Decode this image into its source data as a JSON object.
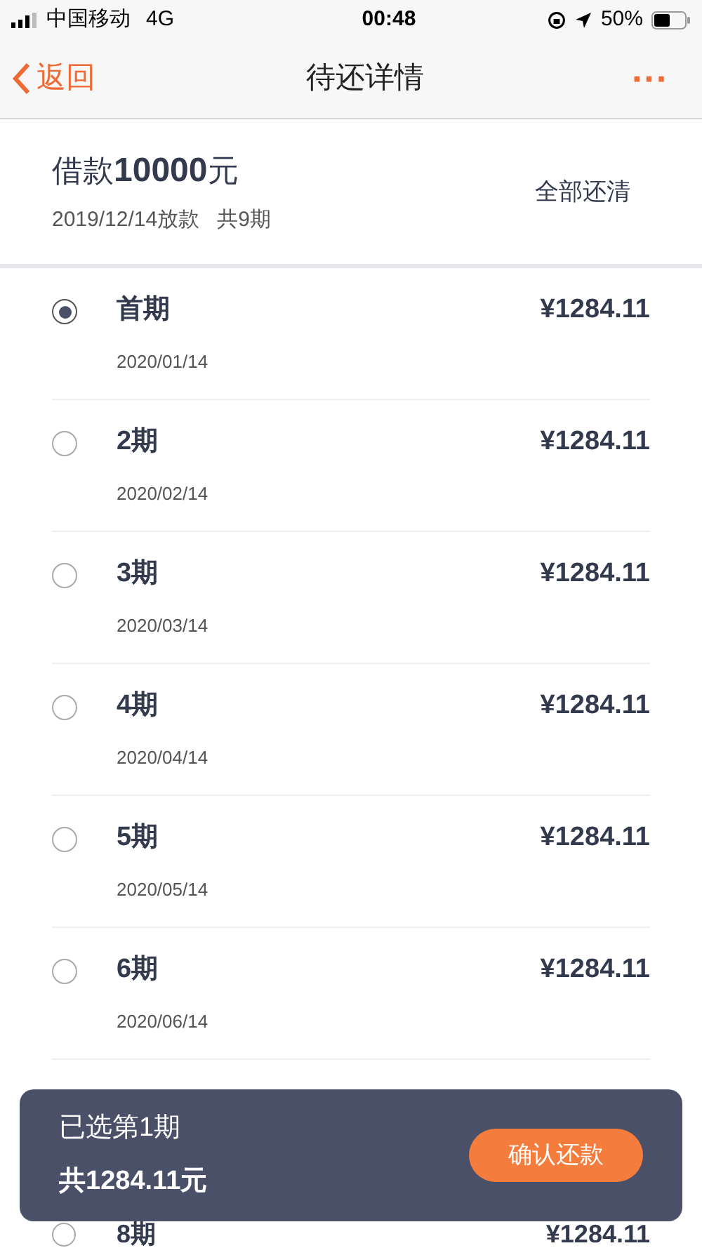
{
  "status_bar": {
    "carrier": "中国移动",
    "network": "4G",
    "time": "00:48",
    "battery": "50%"
  },
  "nav": {
    "back": "返回",
    "title": "待还详情",
    "more": "···"
  },
  "summary": {
    "loan_label": "借款",
    "loan_amount": "10000",
    "loan_unit": "元",
    "info": "2019/12/14放款   共9期",
    "pay_all": "全部还清"
  },
  "installments": [
    {
      "title": "首期",
      "date": "2020/01/14",
      "amount": "¥1284.11",
      "selected": true
    },
    {
      "title": "2期",
      "date": "2020/02/14",
      "amount": "¥1284.11",
      "selected": false
    },
    {
      "title": "3期",
      "date": "2020/03/14",
      "amount": "¥1284.11",
      "selected": false
    },
    {
      "title": "4期",
      "date": "2020/04/14",
      "amount": "¥1284.11",
      "selected": false
    },
    {
      "title": "5期",
      "date": "2020/05/14",
      "amount": "¥1284.11",
      "selected": false
    },
    {
      "title": "6期",
      "date": "2020/06/14",
      "amount": "¥1284.11",
      "selected": false
    },
    {
      "title": "8期",
      "amount": "¥1284.11",
      "selected": false
    }
  ],
  "footer": {
    "selected_text": "已选第1期",
    "total": "共1284.11元",
    "confirm": "确认还款"
  }
}
